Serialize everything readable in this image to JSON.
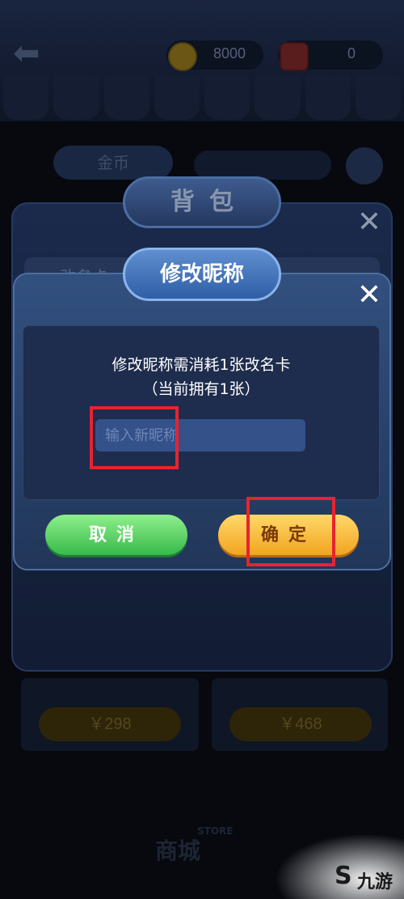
{
  "header": {
    "coins": "8000",
    "tickets": "0"
  },
  "background": {
    "tab_label": "金币",
    "prices": [
      "￥298",
      "￥468"
    ],
    "store_logo": "商城",
    "store_logo_small": "STORE"
  },
  "backpack": {
    "title": "背包",
    "tab_label": "改名卡"
  },
  "dialog": {
    "title": "修改昵称",
    "message_line1": "修改昵称需消耗1张改名卡",
    "message_line2": "（当前拥有1张）",
    "input_placeholder": "输入新昵称",
    "input_value": "",
    "cancel_label": "取消",
    "confirm_label": "确定"
  },
  "watermark": {
    "text": "九游"
  },
  "colors": {
    "highlight": "#e8232f",
    "cancel_green": "#37b94a",
    "confirm_orange": "#f3a41f"
  }
}
